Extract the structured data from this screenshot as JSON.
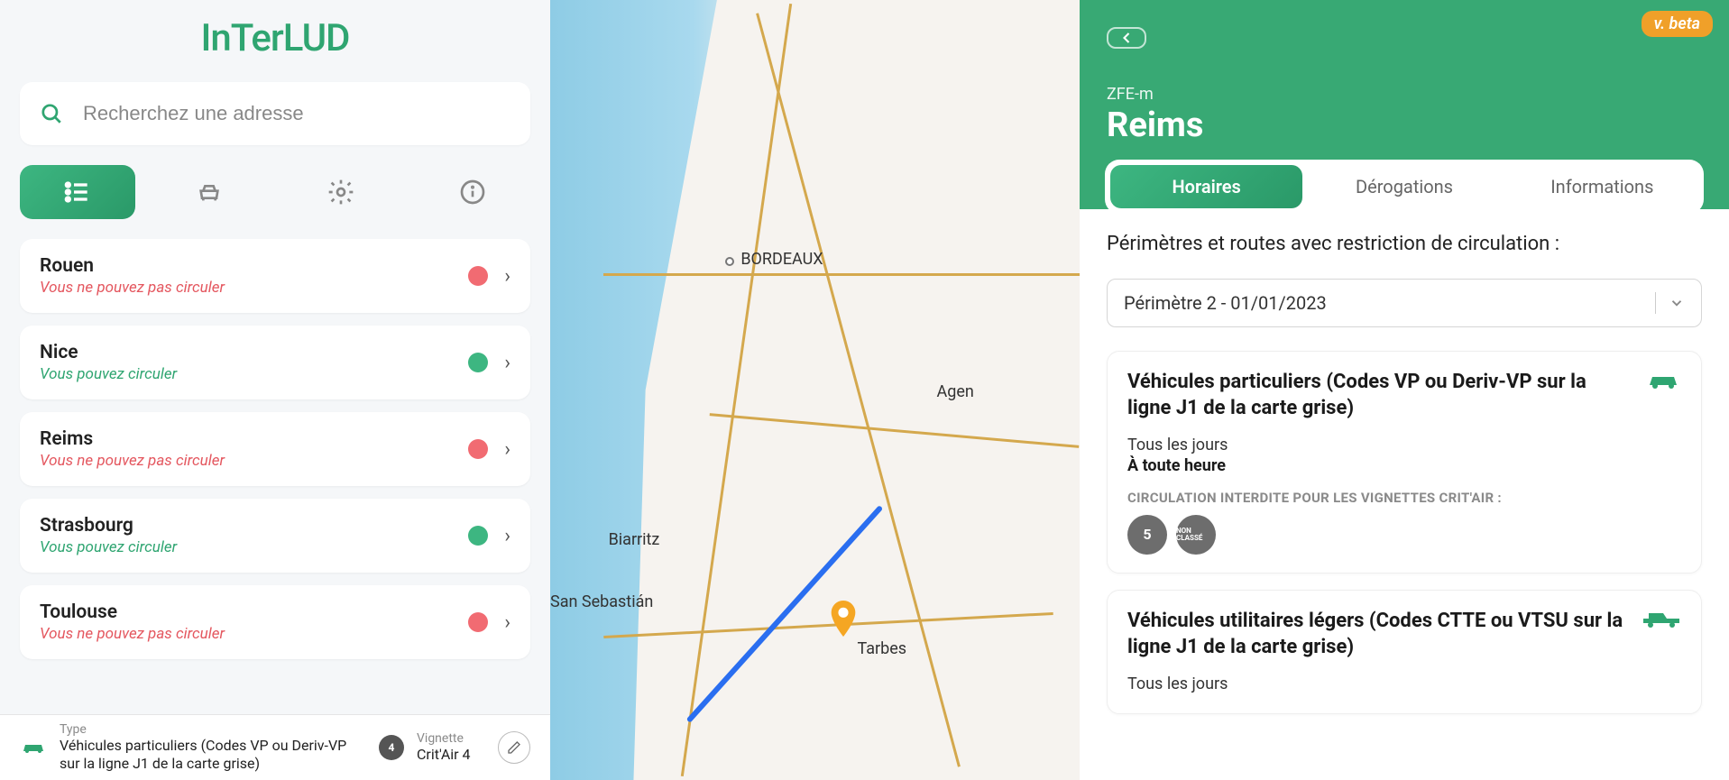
{
  "app": {
    "logo_text": "InTerLUD",
    "beta_label": "v. beta"
  },
  "search": {
    "placeholder": "Recherchez une adresse"
  },
  "left_tabs": [
    {
      "name": "list",
      "active": true
    },
    {
      "name": "vehicle",
      "active": false
    },
    {
      "name": "settings",
      "active": false
    },
    {
      "name": "info",
      "active": false
    }
  ],
  "cities": [
    {
      "name": "Rouen",
      "status_text": "Vous ne pouvez pas circuler",
      "allowed": false
    },
    {
      "name": "Nice",
      "status_text": "Vous pouvez circuler",
      "allowed": true
    },
    {
      "name": "Reims",
      "status_text": "Vous ne pouvez pas circuler",
      "allowed": false
    },
    {
      "name": "Strasbourg",
      "status_text": "Vous pouvez circuler",
      "allowed": true
    },
    {
      "name": "Toulouse",
      "status_text": "Vous ne pouvez pas circuler",
      "allowed": false
    }
  ],
  "bottom": {
    "type_label": "Type",
    "type_value": "Véhicules particuliers (Codes VP ou Deriv-VP sur la ligne J1 de la carte grise)",
    "vignette_label": "Vignette",
    "vignette_value": "Crit'Air 4",
    "vignette_num": "4"
  },
  "map_labels": {
    "bordeaux": "BORDEAUX",
    "agen": "Agen",
    "biarritz": "Biarritz",
    "san_sebastian": "San Sebastián",
    "tarbes": "Tarbes"
  },
  "right": {
    "super": "ZFE-m",
    "title": "Reims",
    "tabs": {
      "horaires": "Horaires",
      "derogations": "Dérogations",
      "informations": "Informations"
    },
    "heading": "Périmètres et routes avec restriction de circulation :",
    "perimeter_selected": "Périmètre 2 - 01/01/2023",
    "cards": [
      {
        "title": "Véhicules particuliers (Codes VP ou Deriv-VP sur la ligne J1 de la carte grise)",
        "icon": "car",
        "days": "Tous les jours",
        "hours": "À toute heure",
        "badges_label": "CIRCULATION INTERDITE POUR LES VIGNETTES CRIT'AIR :",
        "badges": [
          "5",
          "NON CLASSÉ"
        ]
      },
      {
        "title": "Véhicules utilitaires légers (Codes CTTE ou VTSU sur la ligne J1 de la carte grise)",
        "icon": "pickup",
        "days": "Tous les jours",
        "hours": "",
        "badges_label": "",
        "badges": []
      }
    ]
  }
}
